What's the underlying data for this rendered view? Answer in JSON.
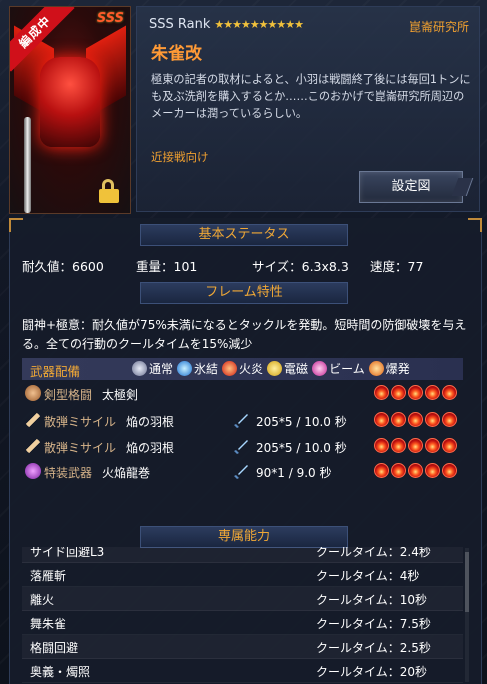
{
  "unit": {
    "badge_status": "編成中",
    "badge_rank": "SSS",
    "rank_label": "SSS  Rank",
    "stars": "★★★★★★★★★★",
    "lab": "崑崙研究所",
    "name": "朱雀改",
    "description": "極東の記者の取材によると、小羽は戦闘終了後には毎回1トンにも及ぶ洗剤を購入するとか……このおかげで崑崙研究所周辺のメーカーは潤っているらしい。",
    "role": "近接戦向け",
    "setting_button": "設定図"
  },
  "sections": {
    "basic": "基本ステータス",
    "frame": "フレーム特性",
    "exclusive": "専属能力"
  },
  "stats": {
    "durability": "耐久値：6600",
    "weight": "重量：101",
    "size": "サイズ：6.3x8.3",
    "speed": "速度：77"
  },
  "frame_trait": "闘神+極意：耐久値が75%未満になるとタックルを発動。短時間の防御破壊を与える。全ての行動のクールタイムを15%減少",
  "weapons": {
    "header": "武器配備",
    "legend": [
      {
        "label": "通常",
        "color": "#a8b0c8",
        "icon": "normal-icon"
      },
      {
        "label": "氷結",
        "color": "#3aa0ff",
        "icon": "ice-icon"
      },
      {
        "label": "火炎",
        "color": "#e02a1a",
        "icon": "fire-icon"
      },
      {
        "label": "電磁",
        "color": "#f0c020",
        "icon": "electric-icon"
      },
      {
        "label": "ビーム",
        "color": "#e040a0",
        "icon": "beam-icon"
      },
      {
        "label": "爆発",
        "color": "#ff7a1a",
        "icon": "explosion-icon"
      }
    ],
    "rows": [
      {
        "type": "剣型格闘",
        "name": "太極剣",
        "damage": "",
        "flames": 5,
        "icon_color": "#c89060"
      },
      {
        "type": "散弾ミサイル",
        "name": "焔の羽根",
        "damage": "205*5 / 10.0 秒",
        "flames": 5,
        "icon_color": "#e0b080"
      },
      {
        "type": "散弾ミサイル",
        "name": "焔の羽根",
        "damage": "205*5 / 10.0 秒",
        "flames": 5,
        "icon_color": "#e0b080"
      },
      {
        "type": "特装武器",
        "name": "火焔龍巻",
        "damage": "90*1 / 9.0 秒",
        "flames": 5,
        "icon_color": "#b040d0"
      }
    ]
  },
  "abilities": [
    {
      "name": "サイド回避L3",
      "cooldown": "クールタイム：2.4秒"
    },
    {
      "name": "落雁斬",
      "cooldown": "クールタイム：4秒"
    },
    {
      "name": "離火",
      "cooldown": "クールタイム：10秒"
    },
    {
      "name": "舞朱雀",
      "cooldown": "クールタイム：7.5秒"
    },
    {
      "name": "格闘回避",
      "cooldown": "クールタイム：2.5秒"
    },
    {
      "name": "奥義・燭照",
      "cooldown": "クールタイム：20秒"
    }
  ]
}
